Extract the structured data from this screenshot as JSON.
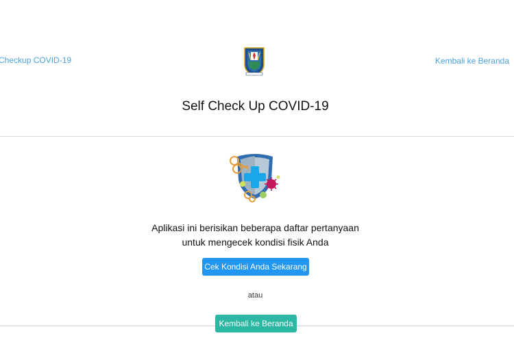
{
  "nav": {
    "left_link": "Checkup COVID-19",
    "right_link": "Kembali ke Beranda"
  },
  "header": {
    "logo_icon": "jatim-emblem-icon",
    "title": "Self Check Up COVID-19"
  },
  "main": {
    "illustration_icon": "shield-virus-icon",
    "description_line1": "Aplikasi ini berisikan beberapa daftar pertanyaan",
    "description_line2": "untuk mengecek kondisi fisik Anda",
    "primary_button": "Cek Kondisi Anda Sekarang",
    "or_text": "atau",
    "secondary_button": "Kembali ke Beranda"
  },
  "colors": {
    "link": "#4aa3df",
    "primary": "#2196f3",
    "teal": "#2bb7a3"
  }
}
